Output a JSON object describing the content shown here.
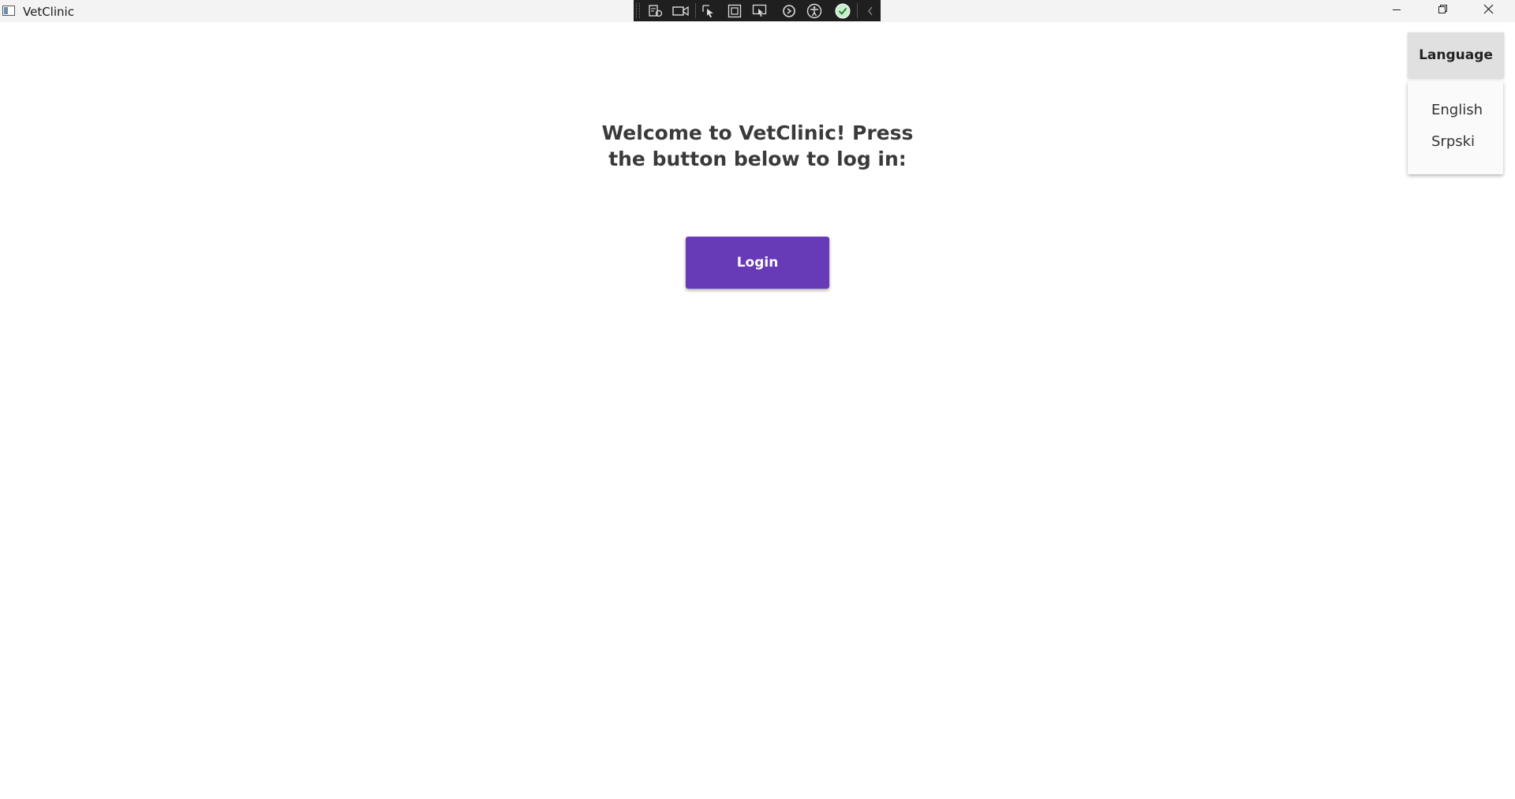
{
  "window": {
    "title": "VetClinic",
    "controls": {
      "minimize_icon": "minimize-icon",
      "maximize_icon": "restore-icon",
      "close_icon": "close-icon"
    }
  },
  "debug_toolbar": {
    "icons": [
      "live-visual-tree-icon",
      "video-camera-icon",
      "select-element-icon",
      "display-layout-adorners-icon",
      "track-focus-icon",
      "hot-reload-icon",
      "accessibility-icon",
      "binding-failures-ok-icon",
      "collapse-chevron-icon"
    ]
  },
  "main": {
    "welcome_text": "Welcome to VetClinic! Press the button below to log in:",
    "login_label": "Login"
  },
  "language": {
    "button_label": "Language",
    "options": [
      "English",
      "Srpski"
    ]
  },
  "colors": {
    "accent": "#673ab7",
    "titlebar": "#f3f3f3",
    "debug_toolbar": "#1f1f1f"
  }
}
